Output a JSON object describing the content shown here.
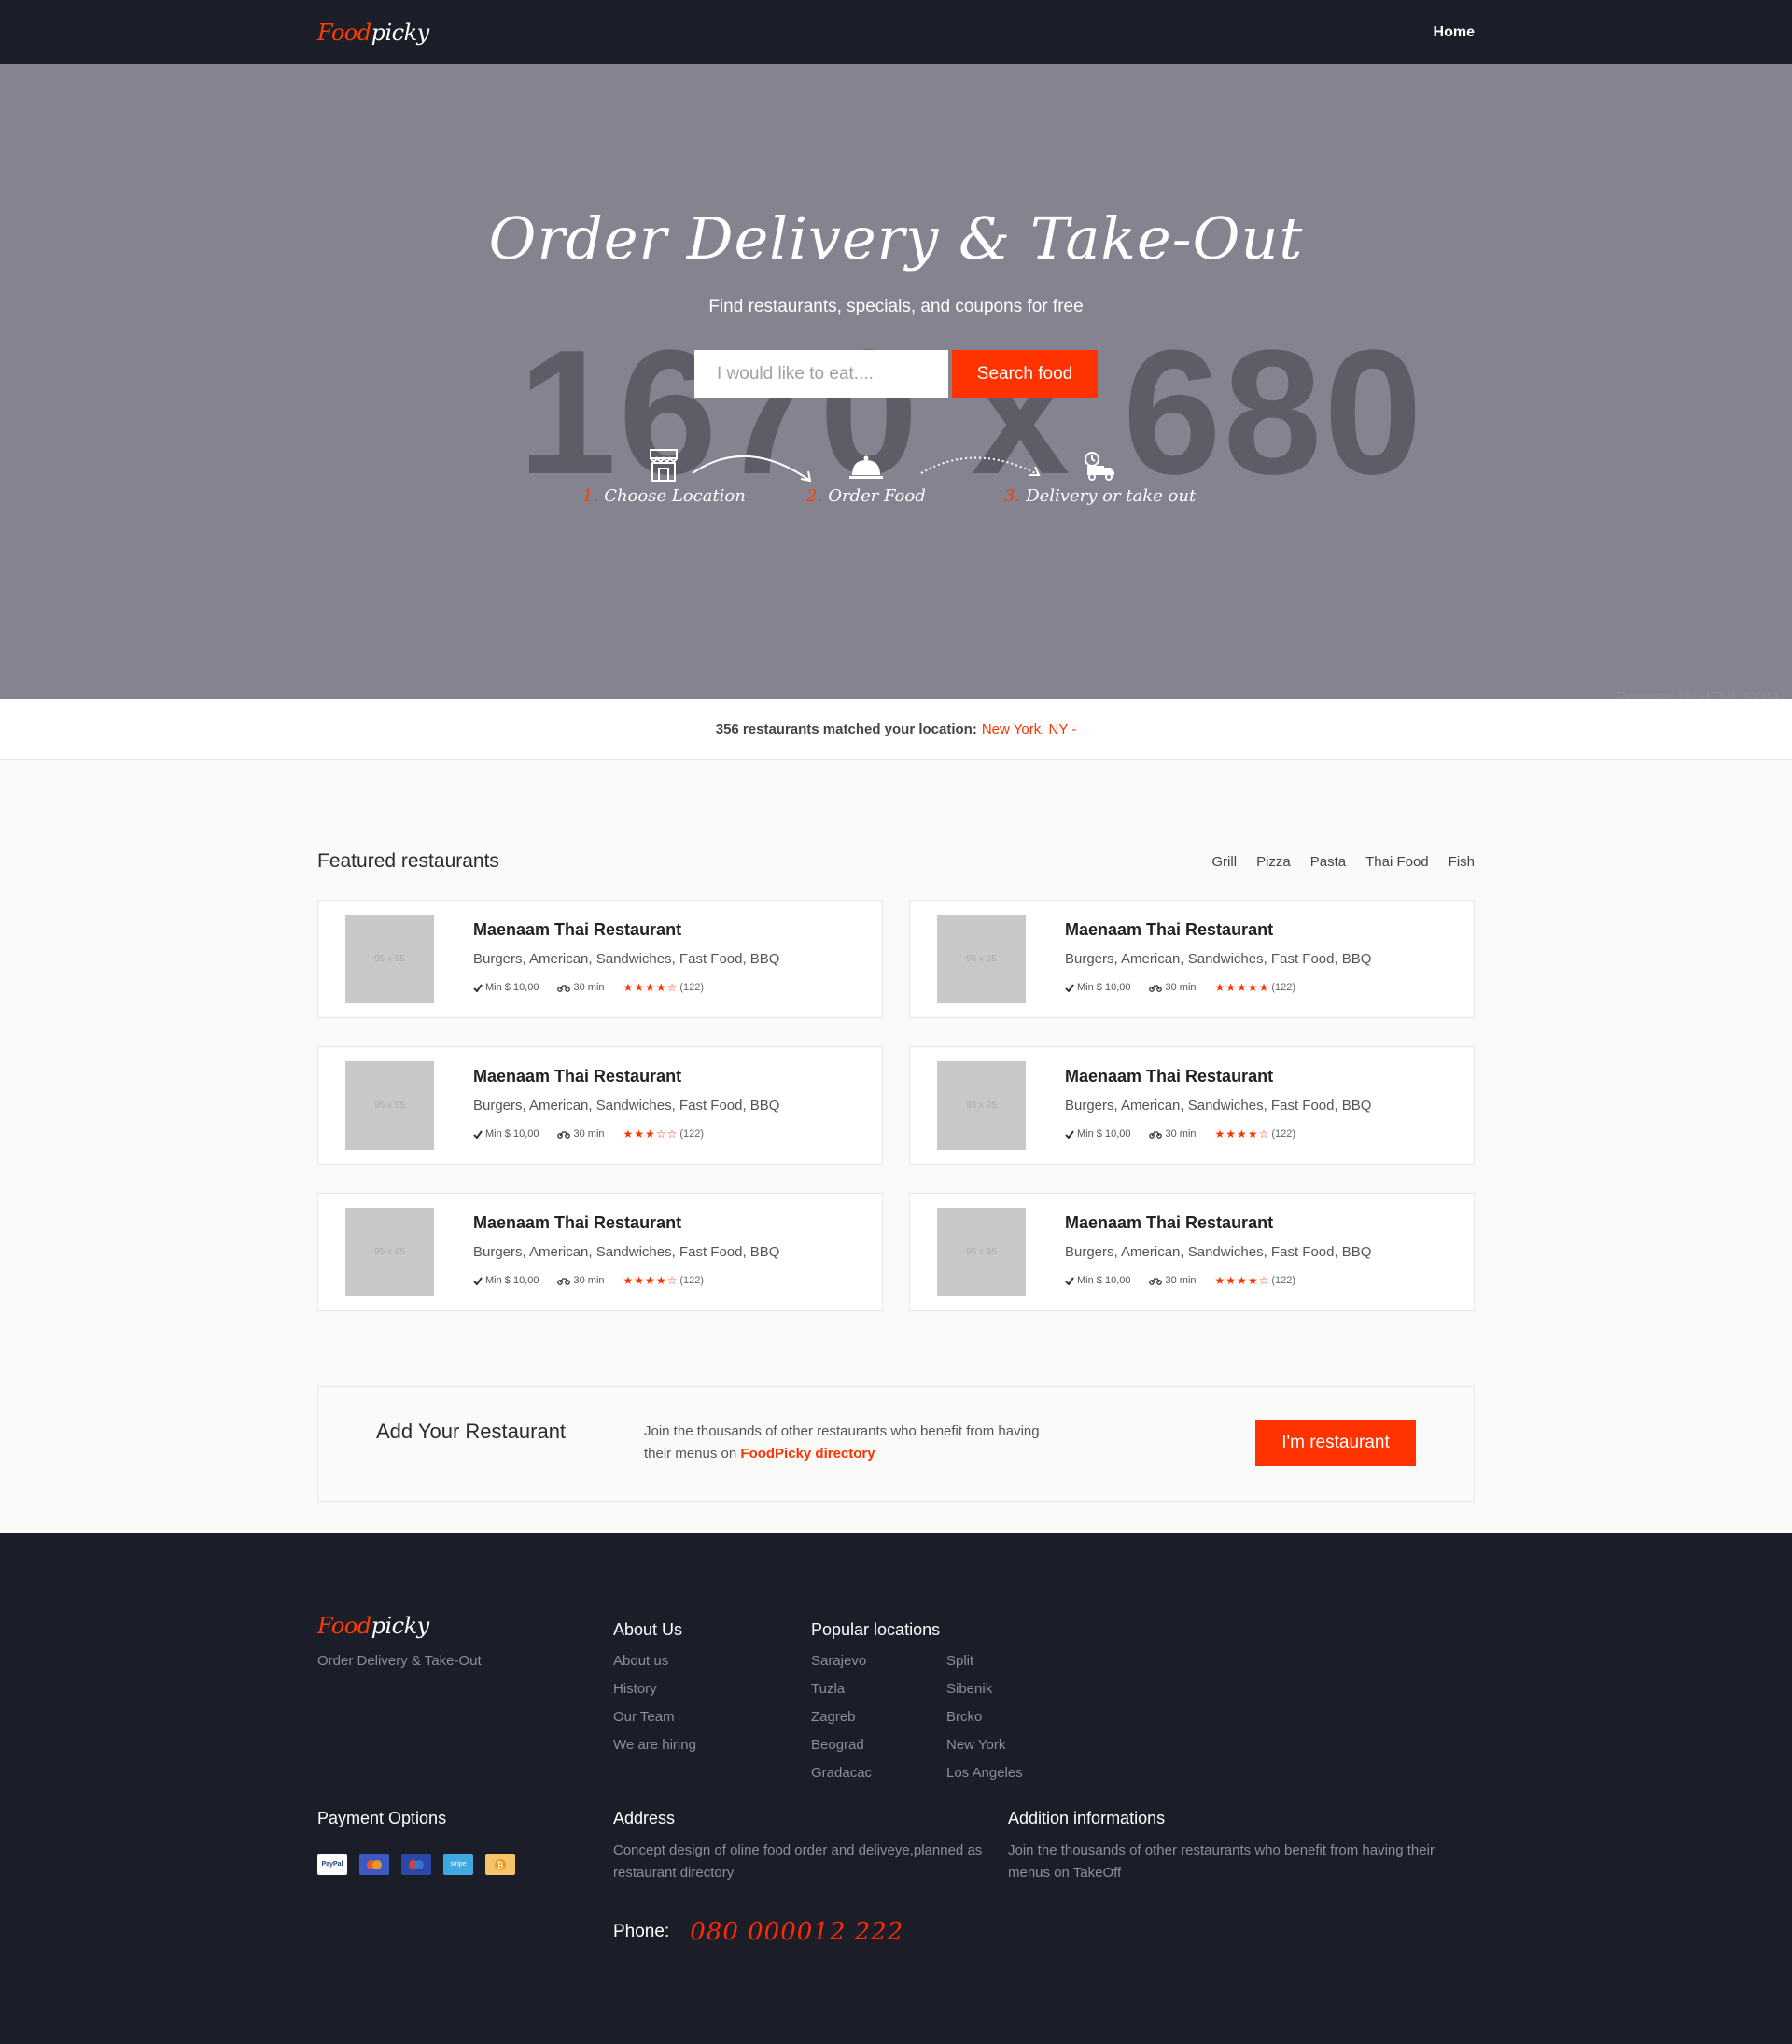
{
  "brand": {
    "part1": "Food",
    "part2": "picky"
  },
  "nav": {
    "home": "Home"
  },
  "hero": {
    "placeholder_text": "1670 x 680",
    "title": "Order Delivery & Take-Out",
    "subtitle": "Find restaurants, specials, and coupons for free",
    "search_placeholder": "I would like to eat....",
    "search_button": "Search food",
    "steps": [
      {
        "num": "1.",
        "label": "Choose Location",
        "icon": "store-icon"
      },
      {
        "num": "2.",
        "label": "Order Food",
        "icon": "cloche-icon"
      },
      {
        "num": "3.",
        "label": "Delivery or take out",
        "icon": "delivery-truck-icon"
      }
    ],
    "powered": "Powered by HTML.COM"
  },
  "location_bar": {
    "text": "356 restaurants matched your location:",
    "city": "New York, NY -"
  },
  "featured": {
    "title": "Featured restaurants",
    "filters": [
      "Grill",
      "Pizza",
      "Pasta",
      "Thai Food",
      "Fish"
    ],
    "restaurants": [
      {
        "thumb": "95 x 95",
        "name": "Maenaam Thai Restaurant",
        "cuisines": "Burgers, American, Sandwiches, Fast Food, BBQ",
        "min": "Min $ 10,00",
        "time": "30 min",
        "rating": 4,
        "reviews": "(122)"
      },
      {
        "thumb": "95 x 95",
        "name": "Maenaam Thai Restaurant",
        "cuisines": "Burgers, American, Sandwiches, Fast Food, BBQ",
        "min": "Min $ 10,00",
        "time": "30 min",
        "rating": 5,
        "reviews": "(122)"
      },
      {
        "thumb": "95 x 95",
        "name": "Maenaam Thai Restaurant",
        "cuisines": "Burgers, American, Sandwiches, Fast Food, BBQ",
        "min": "Min $ 10,00",
        "time": "30 min",
        "rating": 3,
        "reviews": "(122)"
      },
      {
        "thumb": "95 x 95",
        "name": "Maenaam Thai Restaurant",
        "cuisines": "Burgers, American, Sandwiches, Fast Food, BBQ",
        "min": "Min $ 10,00",
        "time": "30 min",
        "rating": 4,
        "reviews": "(122)"
      },
      {
        "thumb": "95 x 95",
        "name": "Maenaam Thai Restaurant",
        "cuisines": "Burgers, American, Sandwiches, Fast Food, BBQ",
        "min": "Min $ 10,00",
        "time": "30 min",
        "rating": 4,
        "reviews": "(122)"
      },
      {
        "thumb": "95 x 95",
        "name": "Maenaam Thai Restaurant",
        "cuisines": "Burgers, American, Sandwiches, Fast Food, BBQ",
        "min": "Min $ 10,00",
        "time": "30 min",
        "rating": 4,
        "reviews": "(122)"
      }
    ]
  },
  "add_restaurant": {
    "title": "Add Your Restaurant",
    "text": "Join the thousands of other restaurants who benefit from having their menus on",
    "link": "FoodPicky directory",
    "button": "I'm restaurant"
  },
  "footer": {
    "tagline": "Order Delivery & Take-Out",
    "about": {
      "title": "About Us",
      "links": [
        "About us",
        "History",
        "Our Team",
        "We are hiring"
      ]
    },
    "locations": {
      "title": "Popular locations",
      "col1": [
        "Sarajevo",
        "Tuzla",
        "Zagreb",
        "Beograd",
        "Gradacac"
      ],
      "col2": [
        "Split",
        "Sibenik",
        "Brcko",
        "New York",
        "Los Angeles"
      ]
    },
    "payment": {
      "title": "Payment Options",
      "methods": [
        {
          "name": "PayPal",
          "color": "#ffffff",
          "text": "PayPal"
        },
        {
          "name": "Mastercard",
          "color": "#3b58c4",
          "text": ""
        },
        {
          "name": "Maestro",
          "color": "#2a48a8",
          "text": ""
        },
        {
          "name": "Stripe",
          "color": "#3fa9e0",
          "text": "stripe"
        },
        {
          "name": "Bitcoin",
          "color": "#f5c46a",
          "text": ""
        }
      ]
    },
    "address": {
      "title": "Address",
      "text": "Concept design of oline food order and deliveye,planned as restaurant directory"
    },
    "addition": {
      "title": "Addition informations",
      "text": "Join the thousands of other restaurants who benefit from having their menus on TakeOff"
    },
    "phone": {
      "label": "Phone:",
      "number": "080 000012 222"
    }
  },
  "colors": {
    "accent": "#ff3300",
    "dark": "#1b1e28",
    "hero": "#858390"
  }
}
